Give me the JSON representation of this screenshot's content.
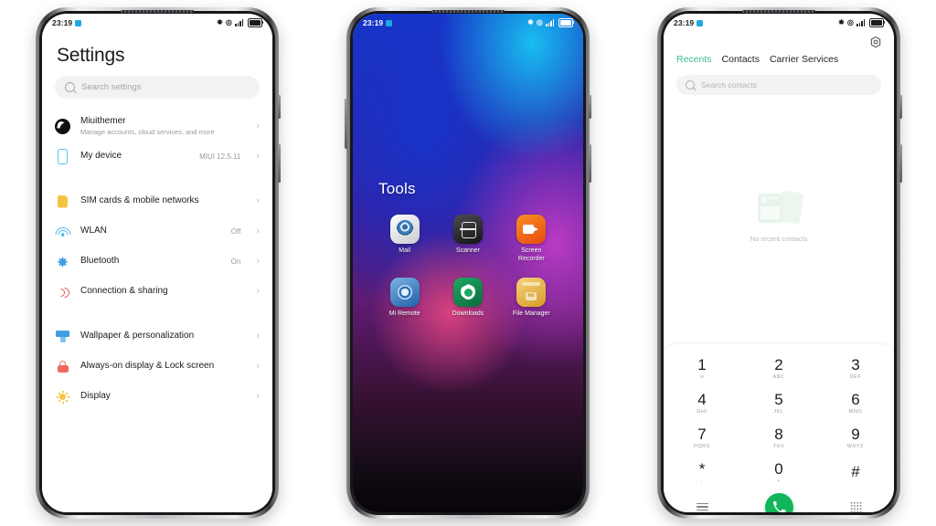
{
  "statusbar": {
    "time": "23:19",
    "icons": [
      "chip-badge",
      "bluetooth-icon",
      "alarm-icon",
      "signal-bars-icon",
      "battery-icon"
    ]
  },
  "phone_settings": {
    "title": "Settings",
    "search": {
      "placeholder": "Search settings",
      "icon": "search-icon"
    },
    "items": [
      {
        "label": "Miuithemer",
        "sub": "Manage accounts, cloud services, and more",
        "value": "",
        "icon": "account-avatar-icon"
      },
      {
        "label": "My device",
        "sub": "",
        "value": "MIUI 12.5.11",
        "icon": "device-icon"
      },
      {
        "label": "SIM cards & mobile networks",
        "sub": "",
        "value": "",
        "icon": "sim-card-icon"
      },
      {
        "label": "WLAN",
        "sub": "",
        "value": "Off",
        "icon": "wifi-icon"
      },
      {
        "label": "Bluetooth",
        "sub": "",
        "value": "On",
        "icon": "bluetooth-icon"
      },
      {
        "label": "Connection & sharing",
        "sub": "",
        "value": "",
        "icon": "connection-sharing-icon"
      },
      {
        "label": "Wallpaper & personalization",
        "sub": "",
        "value": "",
        "icon": "wallpaper-icon"
      },
      {
        "label": "Always-on display & Lock screen",
        "sub": "",
        "value": "",
        "icon": "lock-icon"
      },
      {
        "label": "Display",
        "sub": "",
        "value": "",
        "icon": "brightness-icon"
      }
    ],
    "chevron": "›"
  },
  "phone_home": {
    "folder_title": "Tools",
    "apps": [
      {
        "label": "Mail",
        "icon": "mail-app-icon"
      },
      {
        "label": "Scanner",
        "icon": "scanner-app-icon"
      },
      {
        "label": "Screen Recorder",
        "icon": "screen-recorder-app-icon"
      },
      {
        "label": "Mi Remote",
        "icon": "mi-remote-app-icon"
      },
      {
        "label": "Downloads",
        "icon": "downloads-app-icon"
      },
      {
        "label": "File Manager",
        "icon": "file-manager-app-icon"
      }
    ],
    "wallpaper_colors": [
      "#19bdf0",
      "#1436c7",
      "#b93bc4",
      "#d8417f",
      "#120b14"
    ]
  },
  "phone_dialer": {
    "settings_icon": "gear-icon",
    "tabs": [
      {
        "label": "Recents",
        "active": true
      },
      {
        "label": "Contacts",
        "active": false
      },
      {
        "label": "Carrier Services",
        "active": false
      }
    ],
    "accent_color": "#3ac08a",
    "search": {
      "placeholder": "Search contacts",
      "icon": "search-icon"
    },
    "empty_state": {
      "label": "No recent contacts",
      "icon": "no-contacts-illustration"
    },
    "keys": [
      {
        "digit": "1",
        "letters": "∞"
      },
      {
        "digit": "2",
        "letters": "ABC"
      },
      {
        "digit": "3",
        "letters": "DEF"
      },
      {
        "digit": "4",
        "letters": "GHI"
      },
      {
        "digit": "5",
        "letters": "JKL"
      },
      {
        "digit": "6",
        "letters": "MNO"
      },
      {
        "digit": "7",
        "letters": "PQRS"
      },
      {
        "digit": "8",
        "letters": "TUV"
      },
      {
        "digit": "9",
        "letters": "WXYZ"
      },
      {
        "digit": "*",
        "letters": ","
      },
      {
        "digit": "0",
        "letters": "+"
      },
      {
        "digit": "#",
        "letters": ""
      }
    ],
    "actions": {
      "menu": "menu-icon",
      "call": "call-button",
      "keypad": "keypad-icon"
    },
    "call_button_color": "#12b559"
  }
}
